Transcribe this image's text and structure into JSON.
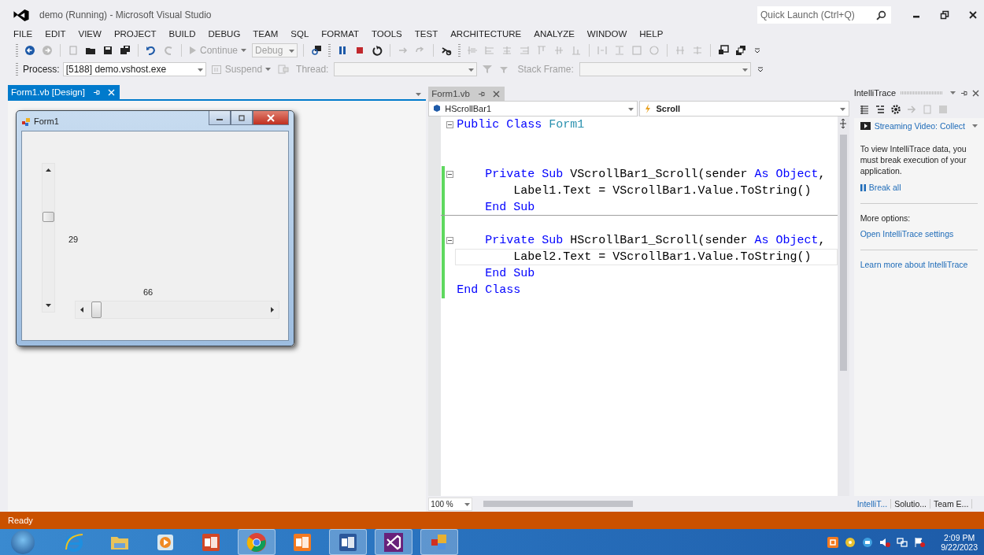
{
  "window": {
    "title": "demo (Running) - Microsoft Visual Studio",
    "quick_launch": {
      "placeholder": "Quick Launch (Ctrl+Q)"
    }
  },
  "menu": [
    "FILE",
    "EDIT",
    "VIEW",
    "PROJECT",
    "BUILD",
    "DEBUG",
    "TEAM",
    "SQL",
    "FORMAT",
    "TOOLS",
    "TEST",
    "ARCHITECTURE",
    "ANALYZE",
    "WINDOW",
    "HELP"
  ],
  "toolbar": {
    "continue": {
      "label": "Continue",
      "disabled": true
    },
    "config": {
      "value": "Debug",
      "disabled": true
    },
    "process_label": "Process:",
    "process": "[5188] demo.vshost.exe",
    "suspend": {
      "label": "Suspend",
      "disabled": true
    },
    "thread_label": "Thread:",
    "stack_frame_label": "Stack Frame:"
  },
  "designer": {
    "tab": {
      "label": "Form1.vb [Design]",
      "selected": true
    },
    "form": {
      "title": "Form1",
      "label1": "29",
      "label2": "66"
    }
  },
  "editor": {
    "tab": {
      "label": "Form1.vb",
      "selected": false
    },
    "type_dropdown": "HScrollBar1",
    "member_dropdown": "Scroll",
    "zoom": "100 %",
    "lines": [
      {
        "kind": "code",
        "collapsible": true,
        "changed": false,
        "current": false,
        "separator": false,
        "tokens": [
          {
            "text": "Public Class ",
            "kind": "keyword"
          },
          {
            "text": "Form1",
            "kind": "type"
          }
        ]
      },
      {
        "kind": "blank",
        "changed": false
      },
      {
        "kind": "blank",
        "changed": false
      },
      {
        "kind": "code",
        "collapsible": true,
        "changed": true,
        "current": false,
        "separator": false,
        "tokens": [
          {
            "text": "    Private Sub ",
            "kind": "keyword"
          },
          {
            "text": "VScrollBar1_Scroll(sender ",
            "kind": "plain"
          },
          {
            "text": "As Object",
            "kind": "keyword"
          },
          {
            "text": ", ",
            "kind": "plain"
          }
        ]
      },
      {
        "kind": "code",
        "collapsible": false,
        "changed": true,
        "current": false,
        "separator": false,
        "tokens": [
          {
            "text": "        Label1.Text = VScrollBar1.Value.ToString()",
            "kind": "plain"
          }
        ]
      },
      {
        "kind": "code",
        "collapsible": false,
        "changed": true,
        "current": false,
        "separator": true,
        "tokens": [
          {
            "text": "    End Sub",
            "kind": "keyword"
          }
        ]
      },
      {
        "kind": "blank",
        "changed": true
      },
      {
        "kind": "code",
        "collapsible": true,
        "changed": true,
        "current": false,
        "separator": false,
        "tokens": [
          {
            "text": "    Private Sub ",
            "kind": "keyword"
          },
          {
            "text": "HScrollBar1_Scroll(sender ",
            "kind": "plain"
          },
          {
            "text": "As Object",
            "kind": "keyword"
          },
          {
            "text": ", ",
            "kind": "plain"
          }
        ]
      },
      {
        "kind": "code",
        "collapsible": false,
        "changed": true,
        "current": true,
        "separator": false,
        "tokens": [
          {
            "text": "        Label2.Text = VScrollBar1.Value.ToString()",
            "kind": "plain"
          }
        ]
      },
      {
        "kind": "code",
        "collapsible": false,
        "changed": true,
        "current": false,
        "separator": false,
        "tokens": [
          {
            "text": "    End Sub",
            "kind": "keyword"
          }
        ]
      },
      {
        "kind": "code",
        "collapsible": false,
        "changed": true,
        "current": false,
        "separator": false,
        "tokens": [
          {
            "text": "End Class",
            "kind": "keyword"
          }
        ]
      }
    ]
  },
  "intellitrace": {
    "title": "IntelliTrace",
    "mode": "Streaming Video: Collect",
    "message": "To view IntelliTrace data, you must break execution of your application.",
    "break_all": "Break all",
    "more_options": "More options:",
    "settings_link": "Open IntelliTrace settings",
    "learn_link": "Learn more about IntelliTrace",
    "tabs": [
      {
        "label": "IntelliT...",
        "selected": true
      },
      {
        "label": "Solutio...",
        "selected": false
      },
      {
        "label": "Team E...",
        "selected": false
      }
    ]
  },
  "status_bar": {
    "text": "Ready"
  },
  "taskbar": {
    "apps": [
      {
        "kind": "ie",
        "open": false
      },
      {
        "kind": "explorer",
        "open": false
      },
      {
        "kind": "media",
        "open": false
      },
      {
        "kind": "powerpoint",
        "open": false
      },
      {
        "kind": "chrome",
        "open": true
      },
      {
        "kind": "xampp",
        "open": false
      },
      {
        "kind": "word",
        "open": true
      },
      {
        "kind": "vs",
        "open": true
      },
      {
        "kind": "forms",
        "open": true
      }
    ],
    "time": "2:09 PM",
    "date": "9/22/2023"
  }
}
